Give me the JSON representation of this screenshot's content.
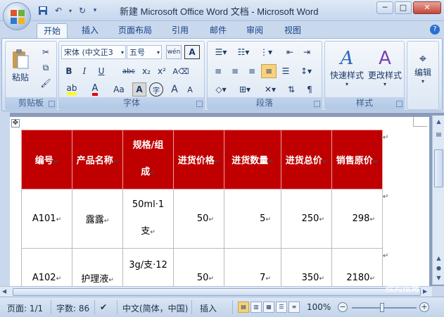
{
  "window": {
    "title": "新建 Microsoft Office Word 文档 - Microsoft Word",
    "minimize": "─",
    "maximize": "□",
    "close": "✕"
  },
  "tabs": [
    "开始",
    "插入",
    "页面布局",
    "引用",
    "邮件",
    "审阅",
    "视图"
  ],
  "active_tab": "开始",
  "ribbon": {
    "clipboard": {
      "paste_label": "粘贴",
      "group_label": "剪贴板"
    },
    "font": {
      "font_name": "宋体 (中文正3",
      "font_size": "五号",
      "group_label": "字体",
      "bold": "B",
      "italic": "I",
      "underline": "U",
      "strike": "abc",
      "subscript": "x₂",
      "superscript": "x²",
      "case": "Aa",
      "grow": "A",
      "shrink": "A",
      "char_border": "A",
      "enclose": "字"
    },
    "paragraph": {
      "group_label": "段落"
    },
    "styles": {
      "quick_styles": "快速样式",
      "change_styles": "更改样式",
      "group_label": "样式"
    },
    "editing": {
      "label": "编辑"
    }
  },
  "table": {
    "headers": [
      "编号",
      "产品名称",
      "规格/组成",
      "进货价格",
      "进货数量",
      "进货总价",
      "销售原价"
    ],
    "header_lines": [
      [
        "编号"
      ],
      [
        "产品名称"
      ],
      [
        "规格/组",
        "成"
      ],
      [
        "进货价格"
      ],
      [
        "进货数量"
      ],
      [
        "进货总价"
      ],
      [
        "销售原价"
      ]
    ],
    "rows": [
      {
        "id": "A101",
        "name": "露露",
        "spec": [
          "50ml·1",
          "支"
        ],
        "price": "50",
        "qty": "5",
        "total": "250",
        "retail": "298"
      },
      {
        "id": "A102",
        "name": "护理液",
        "spec": [
          "3g/支·12",
          ""
        ],
        "price": "50",
        "qty": "7",
        "total": "350",
        "retail": "2180"
      }
    ],
    "paragraph_mark": "↵"
  },
  "status": {
    "page": "页面: 1/1",
    "words": "字数: 86",
    "language": "中文(简体，中国)",
    "mode": "插入",
    "zoom": "100%"
  },
  "watermark": "搜狗指南"
}
